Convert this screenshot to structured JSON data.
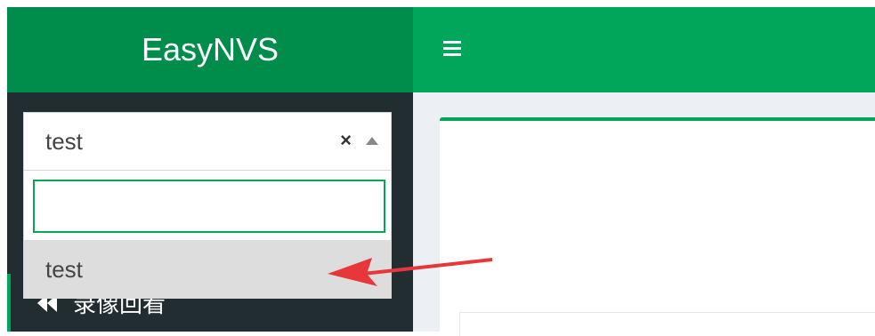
{
  "app": {
    "title": "EasyNVS"
  },
  "topbar": {
    "menu_icon": "hamburger-icon"
  },
  "select": {
    "selected_value": "test",
    "clear_symbol": "×",
    "search_value": "",
    "options": [
      "test"
    ]
  },
  "sidebar": {
    "items": [
      {
        "label": "录像回看",
        "icon": "fast-backward-icon"
      }
    ]
  },
  "colors": {
    "brand_dark": "#008d4c",
    "brand": "#00a65a",
    "sidebar_bg": "#222d32",
    "content_bg": "#ecf0f5",
    "annotation_arrow": "#e8373a"
  }
}
